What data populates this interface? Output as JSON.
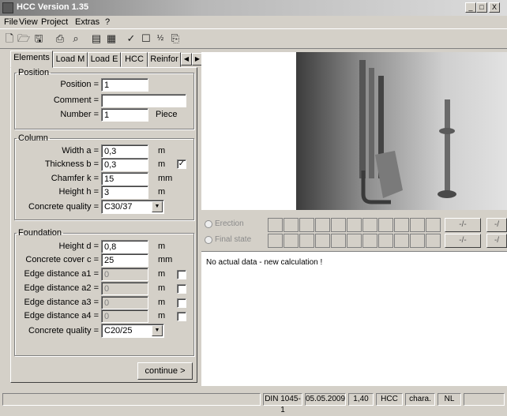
{
  "window": {
    "title": "HCC Version 1.35",
    "min": "_",
    "max": "□",
    "close": "X"
  },
  "menu": [
    "File",
    "View",
    "Project",
    "Extras",
    "?"
  ],
  "toolbar": [
    "new-document",
    "open-folder",
    "save",
    "print",
    "print-preview",
    "report",
    "chart",
    "check",
    "page",
    "fraction-1/2",
    "copy"
  ],
  "tabs": [
    "Elements",
    "Load M",
    "Load E",
    "HCC",
    "Reinfor"
  ],
  "position": {
    "legend": "Position",
    "position_label": "Position =",
    "position_value": "1",
    "comment_label": "Comment =",
    "comment_value": "",
    "number_label": "Number =",
    "number_value": "1",
    "number_unit": "Piece"
  },
  "column": {
    "legend": "Column",
    "width_label": "Width a =",
    "width_value": "0,3",
    "width_unit": "m",
    "thickness_label": "Thickness b =",
    "thickness_value": "0,3",
    "thickness_unit": "m",
    "thickness_checked": true,
    "chamfer_label": "Chamfer k =",
    "chamfer_value": "15",
    "chamfer_unit": "mm",
    "height_label": "Height h =",
    "height_value": "3",
    "height_unit": "m",
    "quality_label": "Concrete quality =",
    "quality_value": "C30/37"
  },
  "foundation": {
    "legend": "Foundation",
    "height_label": "Height d =",
    "height_value": "0,8",
    "height_unit": "m",
    "cover_label": "Concrete cover c =",
    "cover_value": "25",
    "cover_unit": "mm",
    "edge1_label": "Edge distance a1 =",
    "edge1_value": "0",
    "edge1_unit": "m",
    "edge2_label": "Edge distance a2 =",
    "edge2_value": "0",
    "edge2_unit": "m",
    "edge3_label": "Edge distance a3 =",
    "edge3_value": "0",
    "edge3_unit": "m",
    "edge4_label": "Edge distance a4 =",
    "edge4_value": "0",
    "edge4_unit": "m",
    "quality_label": "Concrete quality =",
    "quality_value": "C20/25"
  },
  "continue_label": "continue >",
  "states": {
    "erection_label": "Erection",
    "erection_btn": "-/-",
    "final_label": "Final state",
    "final_btn": "-/-",
    "extra_btn": "-/"
  },
  "output_text": "No actual data - new calculation !",
  "status": [
    "DIN 1045-1",
    "05.05.2009",
    "1,40",
    "HCC",
    "chara.",
    "NL"
  ]
}
